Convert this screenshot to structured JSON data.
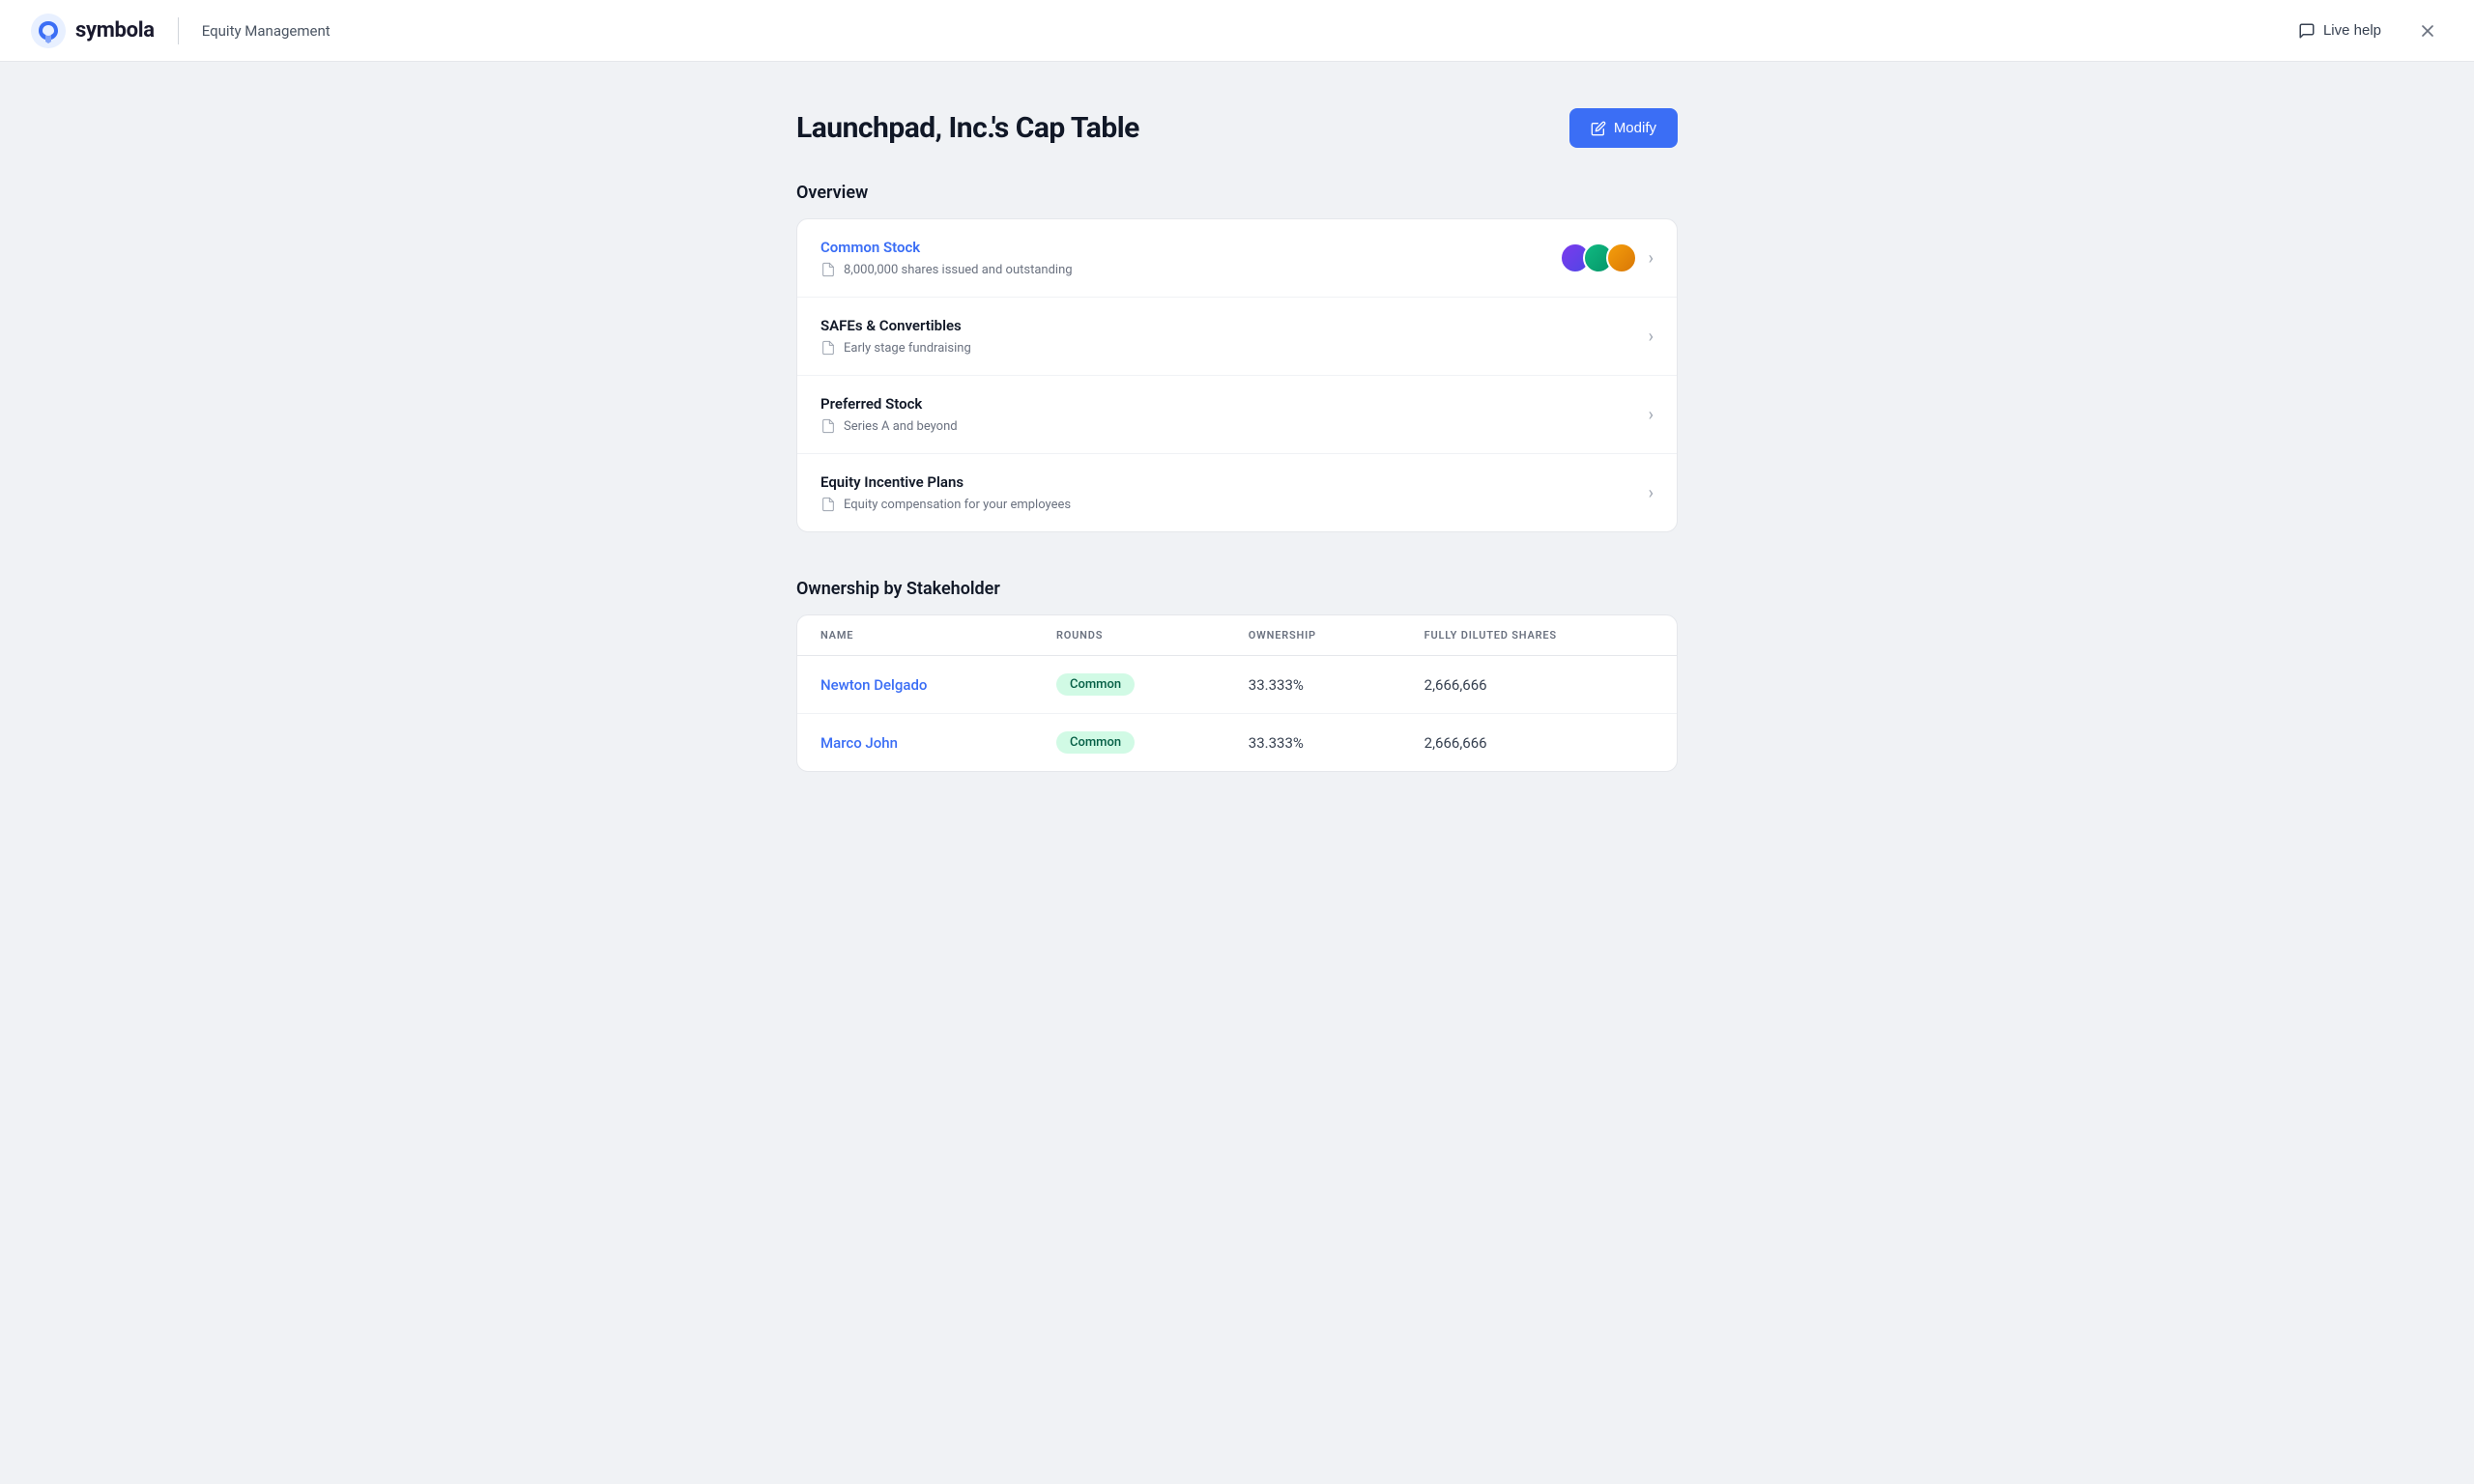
{
  "header": {
    "logo_text": "symbola",
    "app_title": "Equity Management",
    "live_help_label": "Live help",
    "close_label": "×"
  },
  "page": {
    "title": "Launchpad, Inc.'s Cap Table",
    "modify_label": "Modify"
  },
  "overview": {
    "section_title": "Overview",
    "rows": [
      {
        "title": "Common Stock",
        "subtitle": "8,000,000 shares issued and outstanding",
        "blue": true,
        "has_avatars": true
      },
      {
        "title": "SAFEs & Convertibles",
        "subtitle": "Early stage fundraising",
        "blue": false,
        "has_avatars": false
      },
      {
        "title": "Preferred Stock",
        "subtitle": "Series A and beyond",
        "blue": false,
        "has_avatars": false
      },
      {
        "title": "Equity Incentive Plans",
        "subtitle": "Equity compensation for your employees",
        "blue": false,
        "has_avatars": false
      }
    ]
  },
  "ownership": {
    "section_title": "Ownership by Stakeholder",
    "columns": [
      "NAME",
      "ROUNDS",
      "OWNERSHIP",
      "FULLY DILUTED SHARES"
    ],
    "rows": [
      {
        "name": "Newton Delgado",
        "round": "Common",
        "ownership": "33.333%",
        "shares": "2,666,666"
      },
      {
        "name": "Marco John",
        "round": "Common",
        "ownership": "33.333%",
        "shares": "2,666,666"
      }
    ]
  },
  "avatars": [
    {
      "color": "#7c3aed"
    },
    {
      "color": "#10b981"
    },
    {
      "color": "#d97706"
    }
  ]
}
